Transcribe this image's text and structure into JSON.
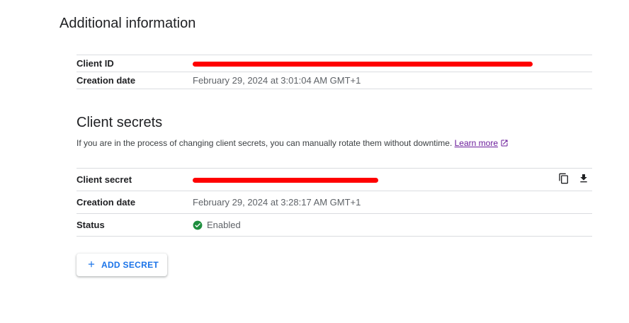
{
  "additional_info": {
    "title": "Additional information",
    "rows": [
      {
        "label": "Client ID",
        "value": "",
        "redacted": true
      },
      {
        "label": "Creation date",
        "value": "February 29, 2024 at 3:01:04 AM GMT+1"
      }
    ]
  },
  "client_secrets": {
    "title": "Client secrets",
    "description": "If you are in the process of changing client secrets, you can manually rotate them without downtime.",
    "learn_more": "Learn more",
    "rows": [
      {
        "label": "Client secret",
        "value": "",
        "redacted": true
      },
      {
        "label": "Creation date",
        "value": "February 29, 2024 at 3:28:17 AM GMT+1"
      },
      {
        "label": "Status",
        "value": "Enabled"
      }
    ],
    "actions": {
      "copy_icon": "copy-icon",
      "download_icon": "download-icon"
    }
  },
  "add_secret": {
    "label": "ADD SECRET",
    "icon": "plus-icon"
  },
  "colors": {
    "accent": "#1a73e8",
    "link": "#6a1b9a",
    "enabled": "#1e8e3e",
    "redaction": "#ff0000"
  }
}
